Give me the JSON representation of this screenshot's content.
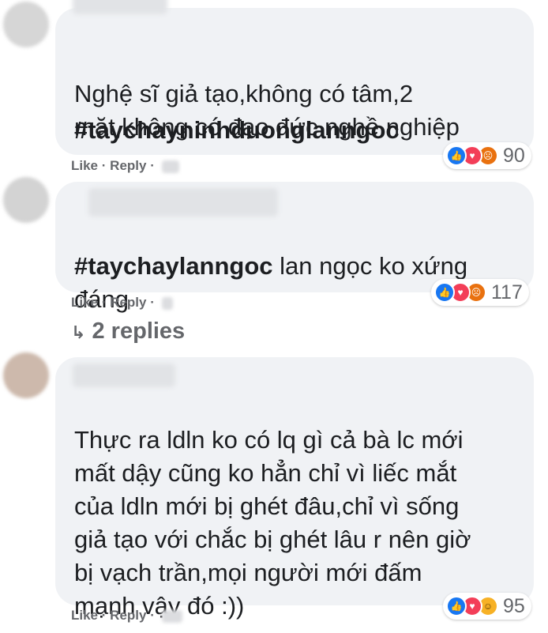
{
  "comments": [
    {
      "text": "Nghệ sĩ giả tạo,không có tâm,2\nmặt,không có đạo đức nghề nghiệp",
      "hashtag": "#taychayninhduonglanngoc",
      "like_label": "Like",
      "reply_label": "Reply",
      "separator": "·",
      "reaction_count": "90",
      "reaction_icons": [
        "like-icon",
        "love-icon",
        "angry-icon"
      ]
    },
    {
      "hashtag": "#taychaylanngoc",
      "text": " lan ngọc ko xứng\nđáng",
      "like_label": "Like",
      "reply_label": "Reply",
      "separator": "·",
      "reaction_count": "117",
      "reaction_icons": [
        "like-icon",
        "love-icon",
        "angry-icon"
      ],
      "replies_label": "2 replies"
    },
    {
      "text": "Thực ra ldln ko có lq gì cả bà lc mới\nmất dậy cũng ko hẳn chỉ vì liếc mắt\ncủa ldln mới bị ghét đâu,chỉ vì sống\ngiả tạo với chắc bị ghét lâu r nên giờ\nbị vạch trần,mọi người mới đấm\nmạnh vậy đó :))",
      "like_label": "Like",
      "reply_label": "Reply",
      "separator": "·",
      "reaction_count": "95",
      "reaction_icons": [
        "like-icon",
        "love-icon",
        "haha-icon"
      ]
    }
  ],
  "colors": {
    "bubble": "#f0f2f5",
    "meta_text": "#65676b",
    "like_blue": "#1877f2",
    "love_red": "#f33e58",
    "angry_orange": "#e9710f",
    "haha_yellow": "#f7b125"
  }
}
